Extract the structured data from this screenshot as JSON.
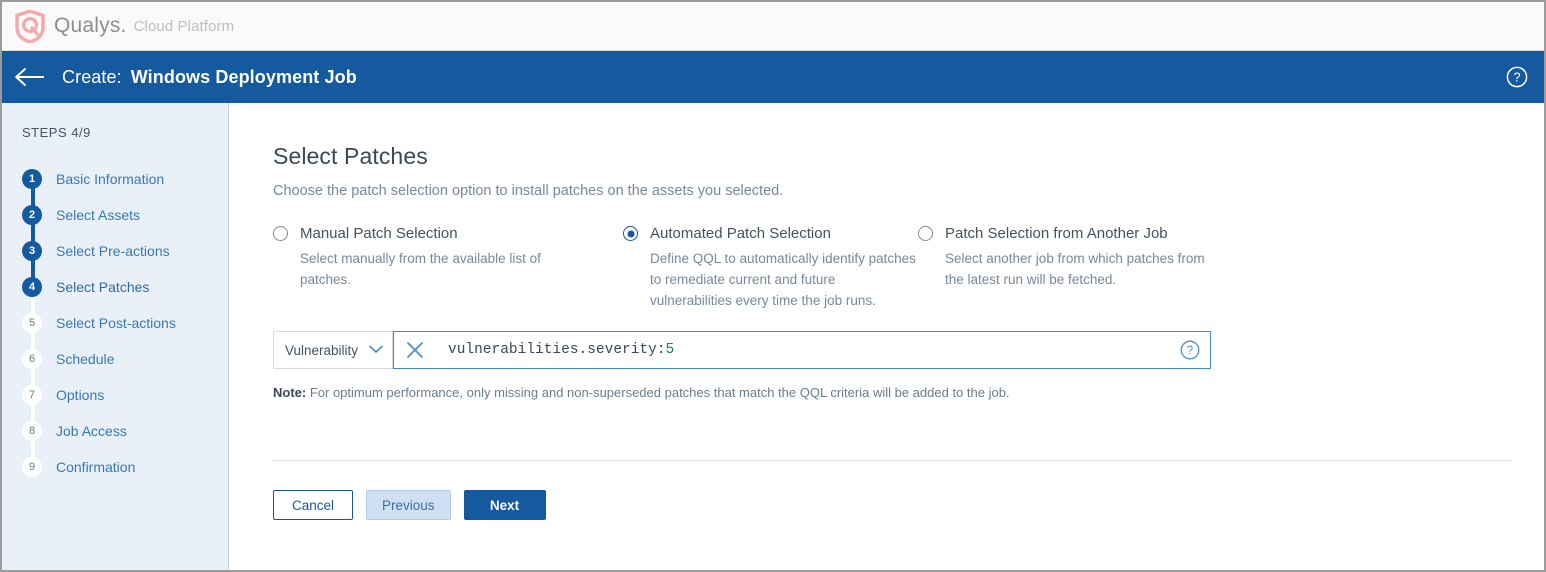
{
  "brand": {
    "logo_icon": "qualys-shield-logo",
    "name": "Qualys.",
    "subtitle": "Cloud Platform"
  },
  "titlebar": {
    "back_icon": "back-arrow-icon",
    "create_label": "Create:",
    "job_name": "Windows Deployment Job",
    "help_icon": "help-circle-icon"
  },
  "sidebar": {
    "steps_label": "STEPS 4/9",
    "items": [
      {
        "number": "1",
        "label": "Basic Information",
        "state": "done"
      },
      {
        "number": "2",
        "label": "Select Assets",
        "state": "done"
      },
      {
        "number": "3",
        "label": "Select Pre-actions",
        "state": "done"
      },
      {
        "number": "4",
        "label": "Select Patches",
        "state": "active"
      },
      {
        "number": "5",
        "label": "Select Post-actions",
        "state": "todo"
      },
      {
        "number": "6",
        "label": "Schedule",
        "state": "todo"
      },
      {
        "number": "7",
        "label": "Options",
        "state": "todo"
      },
      {
        "number": "8",
        "label": "Job Access",
        "state": "todo"
      },
      {
        "number": "9",
        "label": "Confirmation",
        "state": "todo"
      }
    ]
  },
  "main": {
    "title": "Select Patches",
    "subtitle": "Choose the patch selection option to install patches on the assets you selected.",
    "options": [
      {
        "label": "Manual Patch Selection",
        "description": "Select manually from the available list of patches.",
        "selected": false
      },
      {
        "label": "Automated Patch Selection",
        "description": "Define QQL to automatically identify patches to remediate current and future vulnerabilities every time the job runs.",
        "selected": true
      },
      {
        "label": "Patch Selection from Another Job",
        "description": "Select another job from which patches from the latest run will be fetched.",
        "selected": false
      }
    ],
    "qql": {
      "select_value": "Vulnerability",
      "chevron_icon": "chevron-down-icon",
      "clear_icon": "close-x-icon",
      "help_icon": "help-circle-icon",
      "query_field": "vulnerabilities.severity:",
      "query_value": "5",
      "placeholder": ""
    },
    "note_label": "Note:",
    "note_text": " For optimum performance, only missing and non-superseded patches that match the QQL criteria will be added to the job."
  },
  "footer": {
    "cancel_label": "Cancel",
    "previous_label": "Previous",
    "next_label": "Next"
  },
  "colors": {
    "primary_blue": "#15599e",
    "sidebar_bg": "#eaf0f8",
    "link_blue": "#337ab7",
    "qql_value_green": "#1f7a6a",
    "logo_pink": "#f4a8a8"
  }
}
